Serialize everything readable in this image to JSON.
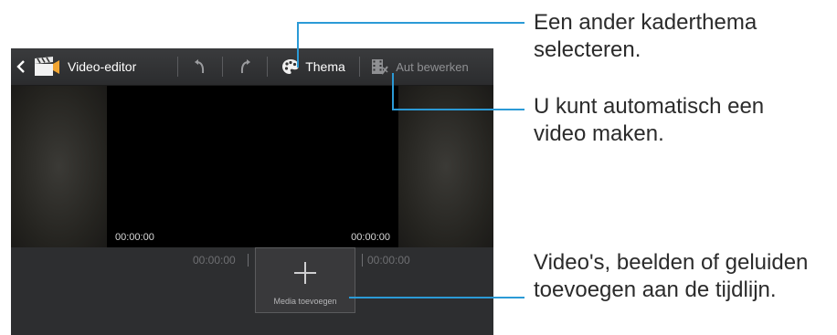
{
  "actionbar": {
    "title": "Video-editor",
    "theme_label": "Thema",
    "auto_edit_label": "Aut bewerken"
  },
  "preview": {
    "start_time": "00:00:00",
    "end_time": "00:00:00"
  },
  "timeline": {
    "left_time": "00:00:00",
    "right_time": "00:00:00",
    "add_media_label": "Media toevoegen"
  },
  "callouts": {
    "theme_line1": "Een ander kaderthema",
    "theme_line2": "selecteren.",
    "auto_line1": "U kunt automatisch een",
    "auto_line2": "video maken.",
    "media_line1": "Video's, beelden of geluiden",
    "media_line2": "toevoegen aan de tijdlijn."
  },
  "colors": {
    "callout_leader": "#2b9ad6",
    "actionbar": "#333436"
  },
  "icons": [
    "back-arrow-icon",
    "clapperboard-icon",
    "undo-icon",
    "redo-icon",
    "palette-icon",
    "auto-edit-film-icon",
    "plus-icon"
  ]
}
